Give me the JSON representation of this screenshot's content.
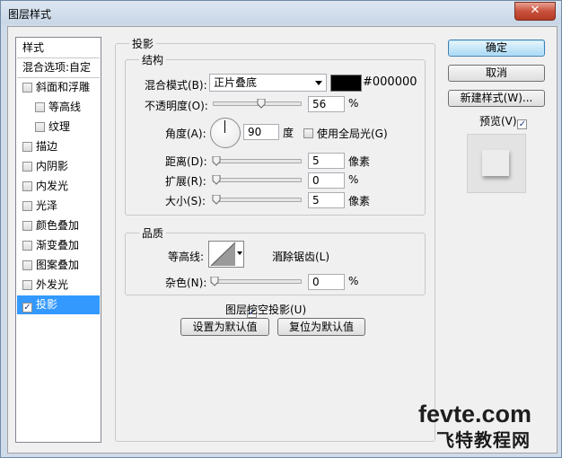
{
  "window": {
    "title": "图层样式",
    "close_glyph": "✕"
  },
  "left_list": {
    "items": [
      {
        "label": "样式",
        "checkbox": false,
        "checked": false,
        "indent": false
      },
      {
        "label": "混合选项:自定",
        "checkbox": false,
        "checked": false,
        "indent": false
      },
      {
        "label": "斜面和浮雕",
        "checkbox": true,
        "checked": false,
        "indent": false
      },
      {
        "label": "等高线",
        "checkbox": true,
        "checked": false,
        "indent": true
      },
      {
        "label": "纹理",
        "checkbox": true,
        "checked": false,
        "indent": true
      },
      {
        "label": "描边",
        "checkbox": true,
        "checked": false,
        "indent": false
      },
      {
        "label": "内阴影",
        "checkbox": true,
        "checked": false,
        "indent": false
      },
      {
        "label": "内发光",
        "checkbox": true,
        "checked": false,
        "indent": false
      },
      {
        "label": "光泽",
        "checkbox": true,
        "checked": false,
        "indent": false
      },
      {
        "label": "颜色叠加",
        "checkbox": true,
        "checked": false,
        "indent": false
      },
      {
        "label": "渐变叠加",
        "checkbox": true,
        "checked": false,
        "indent": false
      },
      {
        "label": "图案叠加",
        "checkbox": true,
        "checked": false,
        "indent": false
      },
      {
        "label": "外发光",
        "checkbox": true,
        "checked": false,
        "indent": false
      },
      {
        "label": "投影",
        "checkbox": true,
        "checked": true,
        "indent": false,
        "selected": true
      }
    ]
  },
  "drop_shadow": {
    "section_title": "投影",
    "structure": {
      "title": "结构",
      "blend_mode_label": "混合模式(B):",
      "blend_mode_value": "正片叠底",
      "color_hex_label": "#000000",
      "color": "#000000",
      "opacity_label": "不透明度(O):",
      "opacity_value": "56",
      "opacity_level": 0.56,
      "percent_unit": "%",
      "angle_label": "角度(A):",
      "angle_value": "90",
      "degree_unit": "度",
      "global_light_label": "使用全局光(G)",
      "global_light_checked": false,
      "distance_label": "距离(D):",
      "distance_value": "5",
      "pixel_unit": "像素",
      "spread_label": "扩展(R):",
      "spread_value": "0",
      "size_label": "大小(S):",
      "size_value": "5"
    },
    "quality": {
      "title": "品质",
      "contour_label": "等高线:",
      "anti_aliased_label": "消除锯齿(L)",
      "anti_aliased_checked": false,
      "noise_label": "杂色(N):",
      "noise_value": "0"
    },
    "knockout_label": "图层挖空投影(U)",
    "knockout_checked": true,
    "make_default_label": "设置为默认值",
    "reset_default_label": "复位为默认值"
  },
  "buttons": {
    "ok": "确定",
    "cancel": "取消",
    "new_style": "新建样式(W)...",
    "preview_label": "预览(V)",
    "preview_checked": true
  },
  "watermark": {
    "line1": "fevte.com",
    "line2": "飞特教程网"
  },
  "colors": {
    "selection": "#3399ff",
    "check": "#1f3a8a"
  }
}
